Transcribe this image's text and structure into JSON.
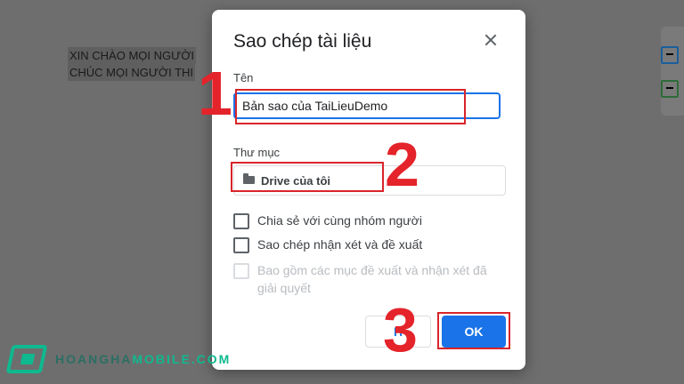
{
  "document": {
    "line1": "XIN CHÀO MỌI NGƯỜI",
    "line2": "CHÚC MỌI NGƯỜI THI"
  },
  "dialog": {
    "title": "Sao chép tài liệu",
    "name_label": "Tên",
    "name_value": "Bản sao của TaiLieuDemo",
    "folder_label": "Thư mục",
    "folder_value": "Drive của tôi",
    "options": [
      {
        "label": "Chia sẻ với cùng nhóm người",
        "checked": false,
        "disabled": false
      },
      {
        "label": "Sao chép nhận xét và đề xuất",
        "checked": false,
        "disabled": false
      },
      {
        "label": "Bao gồm các mục đề xuất và nhận xét đã giải quyết",
        "checked": false,
        "disabled": true
      }
    ],
    "cancel_label": "H",
    "ok_label": "OK"
  },
  "annotations": {
    "step1": "1",
    "step2": "2",
    "step3": "3"
  },
  "watermark": {
    "brand_main": "HOANGHA",
    "brand_rest": "MOBILE.COM"
  },
  "colors": {
    "accent": "#1a73e8",
    "highlight": "#d9252b",
    "brand": "#0fb98f"
  },
  "icons": {
    "close": "close-icon",
    "folder": "folder-icon"
  }
}
